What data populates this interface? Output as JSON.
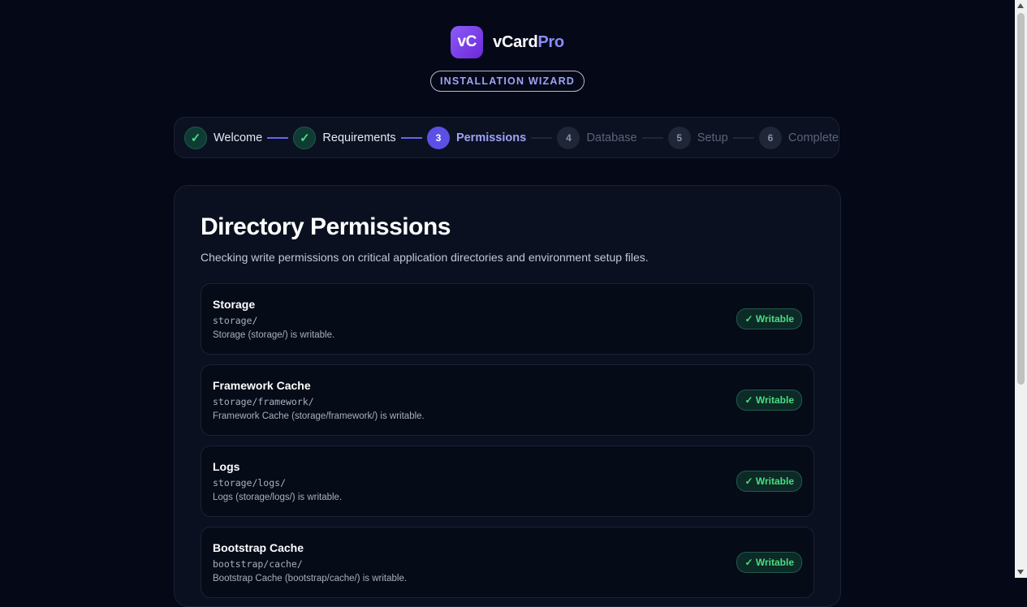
{
  "brand": {
    "logo_initials": "vC",
    "name_main": "vCard",
    "name_accent": "Pro"
  },
  "wizard_label": "INSTALLATION WIZARD",
  "steps": [
    {
      "marker": "✓",
      "label": "Welcome",
      "state": "done"
    },
    {
      "marker": "✓",
      "label": "Requirements",
      "state": "done"
    },
    {
      "marker": "3",
      "label": "Permissions",
      "state": "active"
    },
    {
      "marker": "4",
      "label": "Database",
      "state": "pending"
    },
    {
      "marker": "5",
      "label": "Setup",
      "state": "pending"
    },
    {
      "marker": "6",
      "label": "Complete",
      "state": "pending"
    }
  ],
  "page": {
    "title": "Directory Permissions",
    "subtitle": "Checking write permissions on critical application directories and environment setup files."
  },
  "permissions": [
    {
      "name": "Storage",
      "path": "storage/",
      "desc": "Storage (storage/) is writable.",
      "status": "✓ Writable"
    },
    {
      "name": "Framework Cache",
      "path": "storage/framework/",
      "desc": "Framework Cache (storage/framework/) is writable.",
      "status": "✓ Writable"
    },
    {
      "name": "Logs",
      "path": "storage/logs/",
      "desc": "Logs (storage/logs/) is writable.",
      "status": "✓ Writable"
    },
    {
      "name": "Bootstrap Cache",
      "path": "bootstrap/cache/",
      "desc": "Bootstrap Cache (bootstrap/cache/) is writable.",
      "status": "✓ Writable"
    }
  ],
  "colors": {
    "accent": "#6366f1",
    "success": "#4ade80",
    "background": "#040817"
  }
}
